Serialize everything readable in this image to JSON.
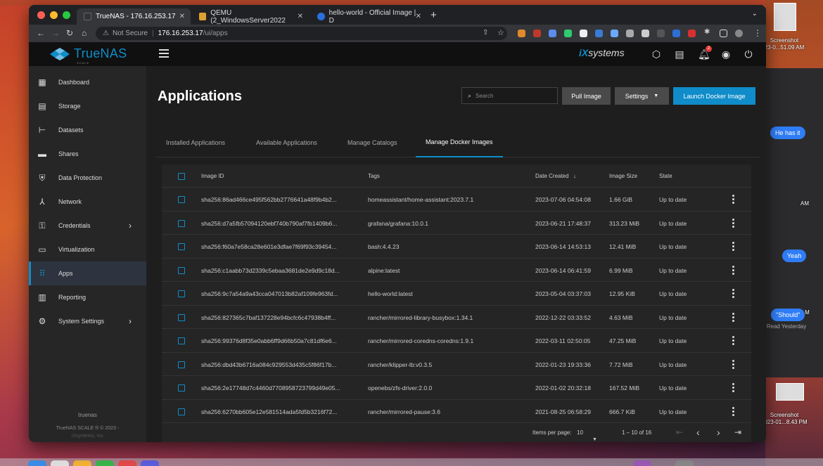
{
  "desktop": {
    "screenshot_top": {
      "label": "Screenshot",
      "caption": "23-0...51.09 AM"
    },
    "screenshot_bottom": {
      "label": "Screenshot",
      "caption": "023-01...8.43 PM"
    },
    "side_letters": {
      "am": "AM",
      "m": "M",
      "pm": "PM"
    },
    "messages": [
      {
        "text": "He has it"
      },
      {
        "text": "Yeah"
      },
      {
        "text": "\"Should\""
      }
    ],
    "read_receipt": "Read Yesterday"
  },
  "browser": {
    "tabs": [
      {
        "title": "TrueNAS - 176.16.253.17",
        "active": true
      },
      {
        "title": "QEMU (2_WindowsServer2022",
        "active": false
      },
      {
        "title": "hello-world - Official Image | D",
        "active": false
      }
    ],
    "new_tab": "+",
    "security": "Not Secure",
    "host": "176.16.253.17",
    "path": "/ui/apps"
  },
  "header": {
    "logo_text": "TrueNAS",
    "logo_sub": "SCALE",
    "vendor": "systems",
    "vendor_prefix": "iX",
    "notification_count": "2"
  },
  "sidebar": {
    "items": [
      {
        "label": "Dashboard",
        "icon": "dashboard-icon"
      },
      {
        "label": "Storage",
        "icon": "storage-icon"
      },
      {
        "label": "Datasets",
        "icon": "datasets-icon"
      },
      {
        "label": "Shares",
        "icon": "shares-icon"
      },
      {
        "label": "Data Protection",
        "icon": "shield-icon"
      },
      {
        "label": "Network",
        "icon": "network-icon"
      },
      {
        "label": "Credentials",
        "icon": "key-icon"
      },
      {
        "label": "Virtualization",
        "icon": "monitor-icon"
      },
      {
        "label": "Apps",
        "icon": "apps-icon"
      },
      {
        "label": "Reporting",
        "icon": "reporting-icon"
      },
      {
        "label": "System Settings",
        "icon": "gear-icon"
      }
    ],
    "hostname": "truenas",
    "copyright": "TrueNAS SCALE ® © 2023 -",
    "company": "iXsystems, Inc"
  },
  "main": {
    "title": "Applications",
    "search_placeholder": "Search",
    "pull_image": "Pull Image",
    "settings": "Settings",
    "launch": "Launch Docker Image",
    "tabs": [
      {
        "label": "Installed Applications"
      },
      {
        "label": "Available Applications"
      },
      {
        "label": "Manage Catalogs"
      },
      {
        "label": "Manage Docker Images"
      }
    ]
  },
  "table": {
    "columns": {
      "image_id": "Image ID",
      "tags": "Tags",
      "date_created": "Date Created",
      "image_size": "Image Size",
      "state": "State"
    },
    "rows": [
      {
        "id": "sha256:86ad466ce495f562bb2776641a48f9b4b2...",
        "tag": "homeassistant/home-assistant:2023.7.1",
        "date": "2023-07-06 04:54:08",
        "size": "1.66 GiB",
        "state": "Up to date"
      },
      {
        "id": "sha256:d7a5fb57094120ebf740b790af7fb1409b6...",
        "tag": "grafana/grafana:10.0.1",
        "date": "2023-06-21 17:48:37",
        "size": "313.23 MiB",
        "state": "Up to date"
      },
      {
        "id": "sha256:f60a7e58ca28e601e3dfae7f69f93c39454...",
        "tag": "bash:4.4.23",
        "date": "2023-06-14 14:53:13",
        "size": "12.41 MiB",
        "state": "Up to date"
      },
      {
        "id": "sha256:c1aabb73d2339c5ebaa3681de2e9d9c18d...",
        "tag": "alpine:latest",
        "date": "2023-06-14 06:41:59",
        "size": "6.99 MiB",
        "state": "Up to date"
      },
      {
        "id": "sha256:9c7a54a9a43cca047013b82af109fe963fd...",
        "tag": "hello-world:latest",
        "date": "2023-05-04 03:37:03",
        "size": "12.95 KiB",
        "state": "Up to date"
      },
      {
        "id": "sha256:827365c7baf137228e94bcfc6c47938b4ff...",
        "tag": "rancher/mirrored-library-busybox:1.34.1",
        "date": "2022-12-22 03:33:52",
        "size": "4.63 MiB",
        "state": "Up to date"
      },
      {
        "id": "sha256:99376d8f35e0abb6ff9d66b50a7c81df6e6...",
        "tag": "rancher/mirrored-coredns-coredns:1.9.1",
        "date": "2022-03-11 02:50:05",
        "size": "47.25 MiB",
        "state": "Up to date"
      },
      {
        "id": "sha256:dbd43b6716a084c929553d435c5f86f17b...",
        "tag": "rancher/klipper-lb:v0.3.5",
        "date": "2022-01-23 19:33:36",
        "size": "7.72 MiB",
        "state": "Up to date"
      },
      {
        "id": "sha256:2e17748d7c4460d7708958723799d49e05...",
        "tag": "openebs/zfs-driver:2.0.0",
        "date": "2022-01-02 20:32:18",
        "size": "167.52 MiB",
        "state": "Up to date"
      },
      {
        "id": "sha256:6270bb605e12e581514ada5fd5b3216f72...",
        "tag": "rancher/mirrored-pause:3.6",
        "date": "2021-08-25 06:58:29",
        "size": "666.7 KiB",
        "state": "Up to date"
      }
    ],
    "pager": {
      "items_label": "Items per page:",
      "page_size": "10",
      "range": "1 – 10 of 16"
    }
  }
}
